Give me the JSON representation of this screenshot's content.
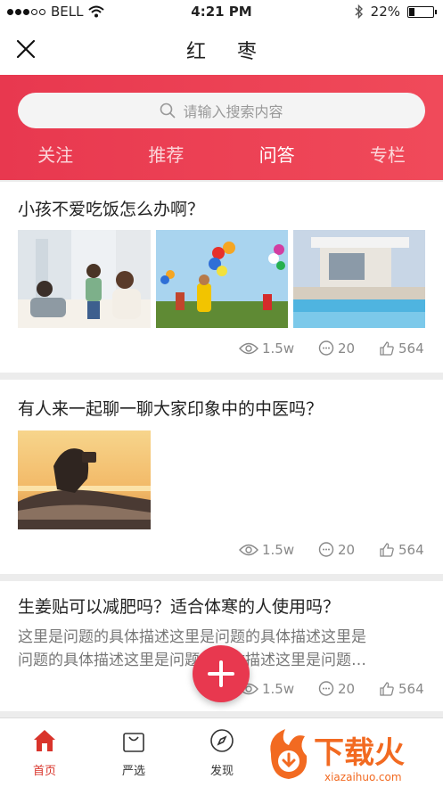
{
  "status": {
    "carrier": "BELL",
    "time": "4:21 PM",
    "battery": "22%",
    "battery_level": 0.22
  },
  "nav": {
    "title": "红 枣"
  },
  "search": {
    "placeholder": "请输入搜索内容"
  },
  "tabs": [
    {
      "label": "关注"
    },
    {
      "label": "推荐"
    },
    {
      "label": "问答"
    },
    {
      "label": "专栏"
    }
  ],
  "active_tab": "问答",
  "questions": [
    {
      "title": "小孩不爱吃饭怎么办啊？",
      "views": "1.5w",
      "comments": "20",
      "likes": "564"
    },
    {
      "title": "有人来一起聊一聊大家印象中的中医吗？",
      "views": "1.5w",
      "comments": "20",
      "likes": "564"
    },
    {
      "title": "生姜贴可以减肥吗？适合体寒的人使用吗？",
      "description_line1": "这里是问题的具体描述这里是问题的具体描述这里是",
      "description_line2": "问题的具体描述这里是问题的具体描述这里是问题…",
      "views": "1.5w",
      "comments": "20",
      "likes": "564"
    }
  ],
  "tabbar": [
    {
      "label": "首页",
      "icon": "home-icon"
    },
    {
      "label": "严选",
      "icon": "shopping-bag-icon"
    },
    {
      "label": "发现",
      "icon": "compass-icon"
    }
  ],
  "watermark": {
    "text": "下载火",
    "url": "xiazaihuo.com"
  },
  "colors": {
    "accent": "#e8384f",
    "tab_active": "#d9342b"
  }
}
